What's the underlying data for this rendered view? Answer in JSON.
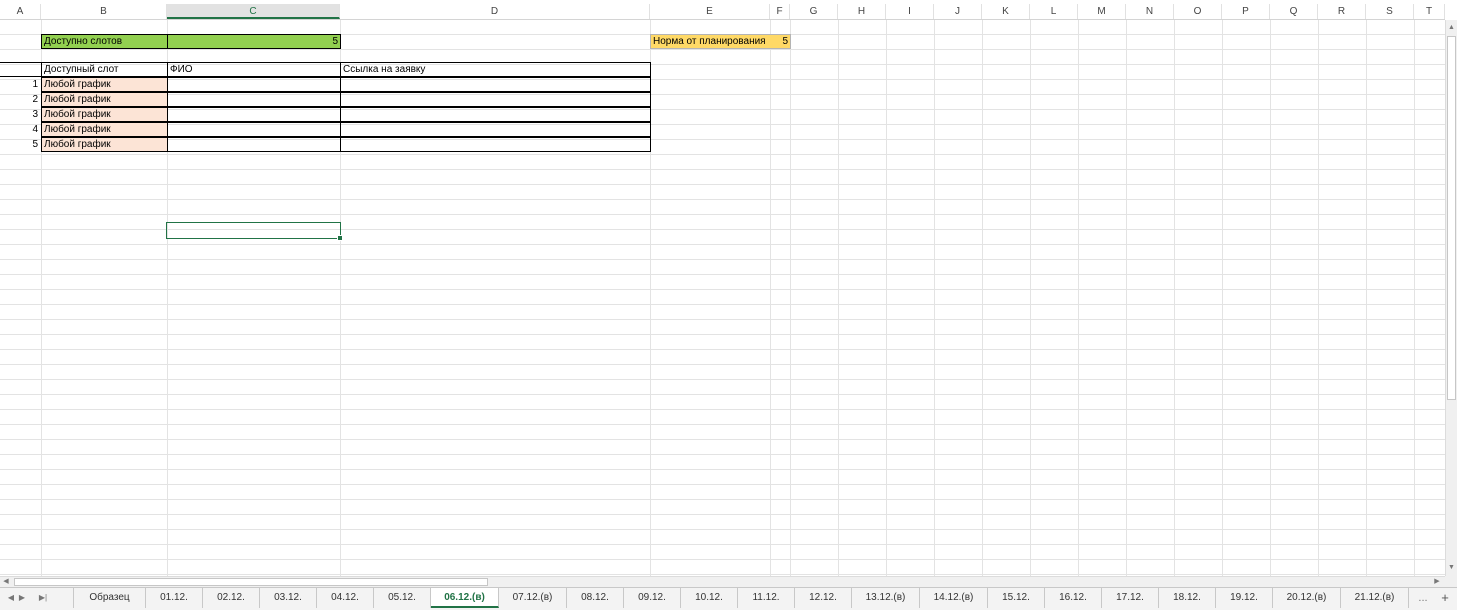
{
  "columns": [
    "A",
    "B",
    "C",
    "D",
    "E",
    "F",
    "G",
    "H",
    "I",
    "J",
    "K",
    "L",
    "M",
    "N",
    "O",
    "P",
    "Q",
    "R",
    "S",
    "T"
  ],
  "active_column": "C",
  "cells": {
    "available_slots_label": "Доступно слотов",
    "available_slots_value": "5",
    "planning_norm_label": "Норма от планирования",
    "planning_norm_value": "5",
    "header_slot": "Доступный слот",
    "header_fio": "ФИО",
    "header_link": "Ссылка на заявку"
  },
  "rows": [
    {
      "num": "1",
      "slot": "Любой график"
    },
    {
      "num": "2",
      "slot": "Любой график"
    },
    {
      "num": "3",
      "slot": "Любой график"
    },
    {
      "num": "4",
      "slot": "Любой график"
    },
    {
      "num": "5",
      "slot": "Любой график"
    }
  ],
  "sheet_tabs": [
    "Образец",
    "01.12.",
    "02.12.",
    "03.12.",
    "04.12.",
    "05.12.",
    "06.12.(в)",
    "07.12.(в)",
    "08.12.",
    "09.12.",
    "10.12.",
    "11.12.",
    "12.12.",
    "13.12.(в)",
    "14.12.(в)",
    "15.12.",
    "16.12.",
    "17.12.",
    "18.12.",
    "19.12.",
    "20.12.(в)",
    "21.12.(в)"
  ],
  "active_tab": "06.12.(в)",
  "tab_nav": {
    "prev": "◀",
    "next": "▶",
    "last": "▶|",
    "more": "...",
    "add": "+"
  },
  "colors": {
    "green_fill": "#92d050",
    "orange_fill": "#ffd966",
    "peach_fill": "#fce4d6",
    "accent": "#217346"
  },
  "icons": {
    "scroll_up": "▲",
    "scroll_down": "▼",
    "scroll_left": "◀",
    "scroll_right": "▶"
  }
}
